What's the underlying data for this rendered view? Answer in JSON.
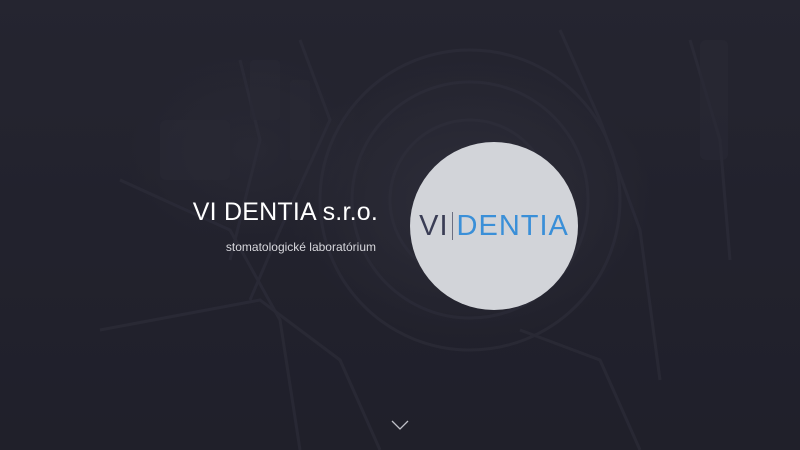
{
  "hero": {
    "company_name": "VI DENTIA s.r.o.",
    "tagline": "stomatologické laboratórium",
    "logo": {
      "left_text": "VI",
      "right_text": "DENTIA",
      "left_color": "#3a3d55",
      "right_color": "#3a8fd8",
      "circle_color": "#d2d4d9"
    },
    "scroll_icon": "chevron-down-icon"
  },
  "colors": {
    "background": "#23232e",
    "title_text": "#ffffff",
    "tagline_text": "#d8d8dd"
  }
}
